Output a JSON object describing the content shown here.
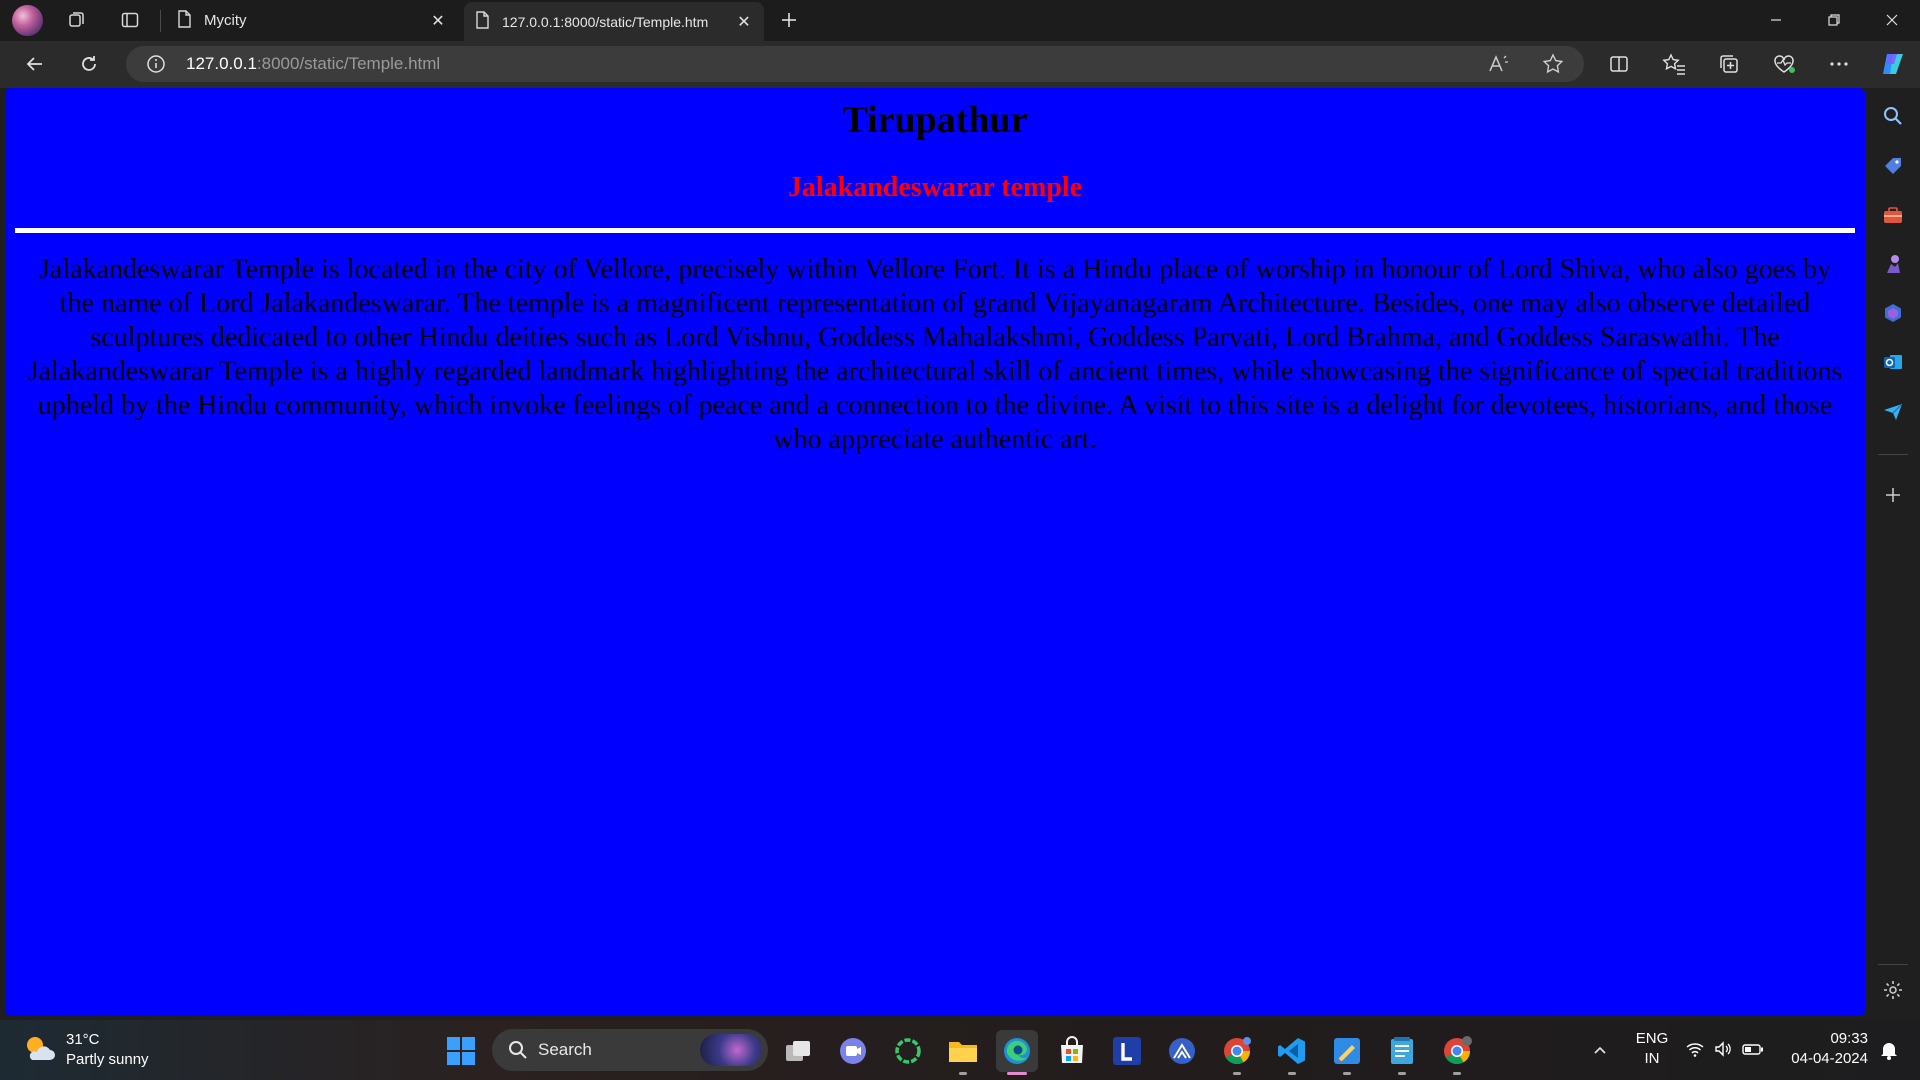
{
  "browser": {
    "tabs": [
      {
        "title": "Mycity",
        "active": false
      },
      {
        "title": "127.0.0.1:8000/static/Temple.htm",
        "active": true
      }
    ],
    "address": {
      "host": "127.0.0.1",
      "path": ":8000/static/Temple.html"
    }
  },
  "page": {
    "background": "#0000ff",
    "title": "Tirupathur",
    "subtitle": "Jalakandeswarar temple",
    "subtitle_color": "#ff0000",
    "body": "Jalakandeswarar Temple is located in the city of Vellore, precisely within Vellore Fort. It is a Hindu place of worship in honour of Lord Shiva, who also goes by the name of Lord Jalakandeswarar. The temple is a magnificent representation of grand Vijayanagaram Architecture. Besides, one may also observe detailed sculptures dedicated to other Hindu deities such as Lord Vishnu, Goddess Mahalakshmi, Goddess Parvati, Lord Brahma, and Goddess Saraswathi. The Jalakandeswarar Temple is a highly regarded landmark highlighting the architectural skill of ancient times, while showcasing the significance of special traditions upheld by the Hindu community, which invoke feelings of peace and a connection to the divine. A visit to this site is a delight for devotees, historians, and those who appreciate authentic art."
  },
  "taskbar": {
    "weather": {
      "temp": "31°C",
      "condition": "Partly sunny"
    },
    "search_label": "Search",
    "tray": {
      "lang_top": "ENG",
      "lang_bottom": "IN",
      "time": "09:33",
      "date": "04-04-2024"
    }
  }
}
